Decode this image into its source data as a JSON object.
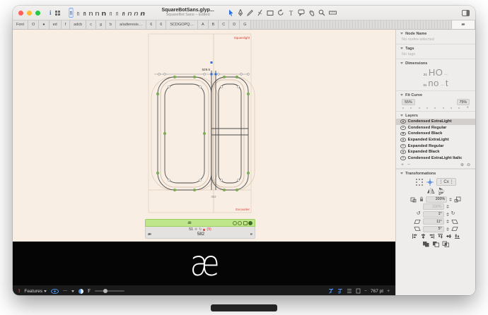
{
  "window": {
    "title": "SquareBotSans.glyp...",
    "subtitle": "SquareBot Sans – Edited"
  },
  "toolbar": {
    "master_glyph": "n",
    "info_glyph": "i",
    "tools": [
      "select-tool",
      "pen-tool",
      "pencil-tool",
      "knife-tool",
      "shape-tool",
      "rotate-tool",
      "text-tool",
      "annotation-tool",
      "hand-tool",
      "zoom-tool",
      "measure-tool"
    ]
  },
  "tabbar": {
    "tabs": [
      "Font",
      "O",
      "●",
      "ed",
      "f",
      "adcb",
      "c",
      "g",
      "b",
      "a/adieresis…",
      "6",
      "6",
      "SCDGOPQ…",
      "A",
      "B",
      "C",
      "D",
      "G"
    ],
    "active_tab": "æ"
  },
  "canvas": {
    "measurement": "629.5",
    "measurement2": "463",
    "guide_label_top": "Squarelight",
    "guide_label_bottom": "Excounter",
    "info_box": {
      "glyph": "æ",
      "row_value": "51",
      "anchor_badge": "(9)",
      "width": "582",
      "left_key": "æ",
      "right_key": "e"
    }
  },
  "sidebar": {
    "node_name": {
      "title": "Node Name",
      "empty": "No nodes selected"
    },
    "tags": {
      "title": "Tags",
      "empty": "No tags"
    },
    "dimensions": {
      "title": "Dimensions",
      "row1_value": "21",
      "row1_sample": "HO",
      "row1_dash": "—",
      "row2_value": "31",
      "row2_sample": "no",
      "row2_dash": "—",
      "row2_extra": "t"
    },
    "fit_curve": {
      "title": "Fit Curve",
      "min": "55%",
      "max": "75%",
      "plus": "+"
    },
    "layers": {
      "title": "Layers",
      "items": [
        {
          "name": "Condensed ExtraLight",
          "selected": true
        },
        {
          "name": "Condensed Regular",
          "selected": false
        },
        {
          "name": "Condensed Black",
          "selected": false
        },
        {
          "name": "Expanded ExtraLight",
          "selected": false
        },
        {
          "name": "Expanded Regular",
          "selected": false
        },
        {
          "name": "Expanded Black",
          "selected": false
        },
        {
          "name": "Condensed ExtraLight Italic",
          "selected": false
        }
      ],
      "add": "+",
      "remove": "−"
    },
    "transformations": {
      "title": "Transformations",
      "origin_label": "Cx",
      "scale": "200%",
      "scale_linked": "100%",
      "rotate": "1°",
      "slant": "11°",
      "skew": "5°"
    }
  },
  "preview": {
    "glyph": "æ"
  },
  "bottombar": {
    "alert": "!",
    "features_label": "Features",
    "f_label": "F",
    "minus": "−",
    "plus": "+",
    "zoom_value": "767 pt"
  }
}
